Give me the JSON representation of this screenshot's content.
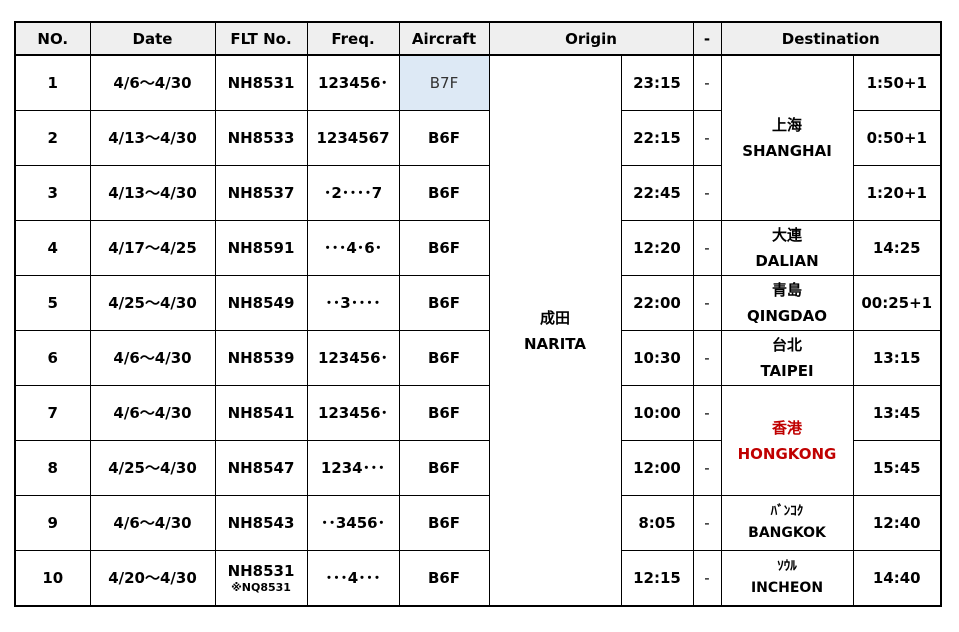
{
  "headers": {
    "no": "NO.",
    "date": "Date",
    "flt": "FLT No.",
    "freq": "Freq.",
    "aircraft": "Aircraft",
    "origin": "Origin",
    "dash": "-",
    "destination": "Destination"
  },
  "origin": {
    "jp": "成田",
    "en": "NARITA"
  },
  "dash": "-",
  "colors": {
    "highlight_text": "#c00000",
    "highlight_cell": "#dde9f5"
  },
  "rows": [
    {
      "no": "1",
      "date": "4/6～4/30",
      "flt": "NH8531",
      "freq": "123456･",
      "aircraft": "B7F",
      "dep": "23:15",
      "arr": "1:50+1"
    },
    {
      "no": "2",
      "date": "4/13～4/30",
      "flt": "NH8533",
      "freq": "1234567",
      "aircraft": "B6F",
      "dep": "22:15",
      "arr": "0:50+1"
    },
    {
      "no": "3",
      "date": "4/13～4/30",
      "flt": "NH8537",
      "freq": "･2････7",
      "aircraft": "B6F",
      "dep": "22:45",
      "arr": "1:20+1"
    },
    {
      "no": "4",
      "date": "4/17～4/25",
      "flt": "NH8591",
      "freq": "･･･4･6･",
      "aircraft": "B6F",
      "dep": "12:20",
      "arr": "14:25"
    },
    {
      "no": "5",
      "date": "4/25～4/30",
      "flt": "NH8549",
      "freq": "･･3････",
      "aircraft": "B6F",
      "dep": "22:00",
      "arr": "00:25+1"
    },
    {
      "no": "6",
      "date": "4/6～4/30",
      "flt": "NH8539",
      "freq": "123456･",
      "aircraft": "B6F",
      "dep": "10:30",
      "arr": "13:15"
    },
    {
      "no": "7",
      "date": "4/6～4/30",
      "flt": "NH8541",
      "freq": "123456･",
      "aircraft": "B6F",
      "dep": "10:00",
      "arr": "13:45"
    },
    {
      "no": "8",
      "date": "4/25～4/30",
      "flt": "NH8547",
      "freq": "1234･･･",
      "aircraft": "B6F",
      "dep": "12:00",
      "arr": "15:45"
    },
    {
      "no": "9",
      "date": "4/6～4/30",
      "flt": "NH8543",
      "freq": "･･3456･",
      "aircraft": "B6F",
      "dep": "8:05",
      "arr": "12:40"
    },
    {
      "no": "10",
      "date": "4/20～4/30",
      "flt": "NH8531",
      "flt_note": "※NQ8531",
      "freq": "･･･4･･･",
      "aircraft": "B6F",
      "dep": "12:15",
      "arr": "14:40"
    }
  ],
  "destinations": {
    "shanghai": {
      "jp": "上海",
      "en": "SHANGHAI"
    },
    "dalian": {
      "jp": "大連",
      "en": "DALIAN"
    },
    "qingdao": {
      "jp": "青島",
      "en": "QINGDAO"
    },
    "taipei": {
      "jp": "台北",
      "en": "TAIPEI"
    },
    "hongkong": {
      "jp": "香港",
      "en": "HONGKONG"
    },
    "bangkok": {
      "jp": "ﾊﾞﾝｺｸ",
      "en": "BANGKOK"
    },
    "incheon": {
      "jp": "ｿｳﾙ",
      "en": "INCHEON"
    }
  }
}
